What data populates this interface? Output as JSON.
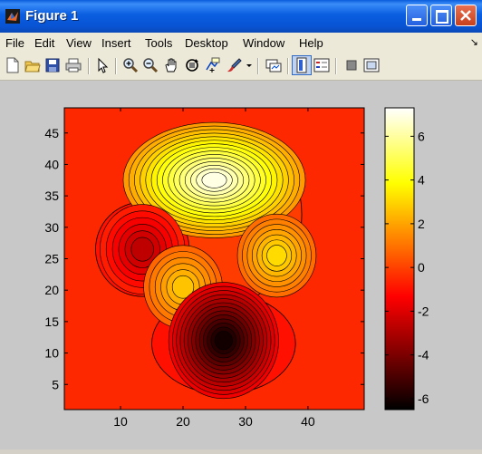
{
  "window": {
    "title": "Figure 1"
  },
  "menu": {
    "items": [
      "File",
      "Edit",
      "View",
      "Insert",
      "Tools",
      "Desktop",
      "Window",
      "Help"
    ],
    "overflow": "↘"
  },
  "toolbar": {
    "icons": [
      "new-figure-icon",
      "open-file-icon",
      "save-icon",
      "print-icon",
      "edit-plot-arrow-icon",
      "zoom-in-icon",
      "zoom-out-icon",
      "pan-hand-icon",
      "rotate-3d-icon",
      "data-cursor-icon",
      "brush-icon",
      "brush-dropdown-icon",
      "link-plot-icon",
      "colorbar-icon",
      "legend-icon",
      "hide-plot-tools-icon",
      "show-plot-tools-icon"
    ]
  },
  "chart_data": {
    "type": "contour",
    "colormap": "hot",
    "xlim": [
      1,
      49
    ],
    "ylim": [
      1,
      49
    ],
    "xticks": [
      "10",
      "20",
      "30",
      "40"
    ],
    "yticks": [
      "5",
      "10",
      "15",
      "20",
      "25",
      "30",
      "35",
      "40",
      "45"
    ],
    "colorbar": {
      "range": [
        -6.5,
        7.3
      ],
      "ticks": [
        "6",
        "4",
        "2",
        "0",
        "-2",
        "-4",
        "-6"
      ]
    },
    "features": [
      {
        "x": 25,
        "y": 37.5,
        "z": 7.3
      },
      {
        "x": 13.5,
        "y": 26.5,
        "z": -3.0
      },
      {
        "x": 35,
        "y": 25.5,
        "z": 3.5
      },
      {
        "x": 20,
        "y": 20.5,
        "z": 3.0
      },
      {
        "x": 26.5,
        "y": 12,
        "z": -6.5
      }
    ],
    "grid": false
  }
}
